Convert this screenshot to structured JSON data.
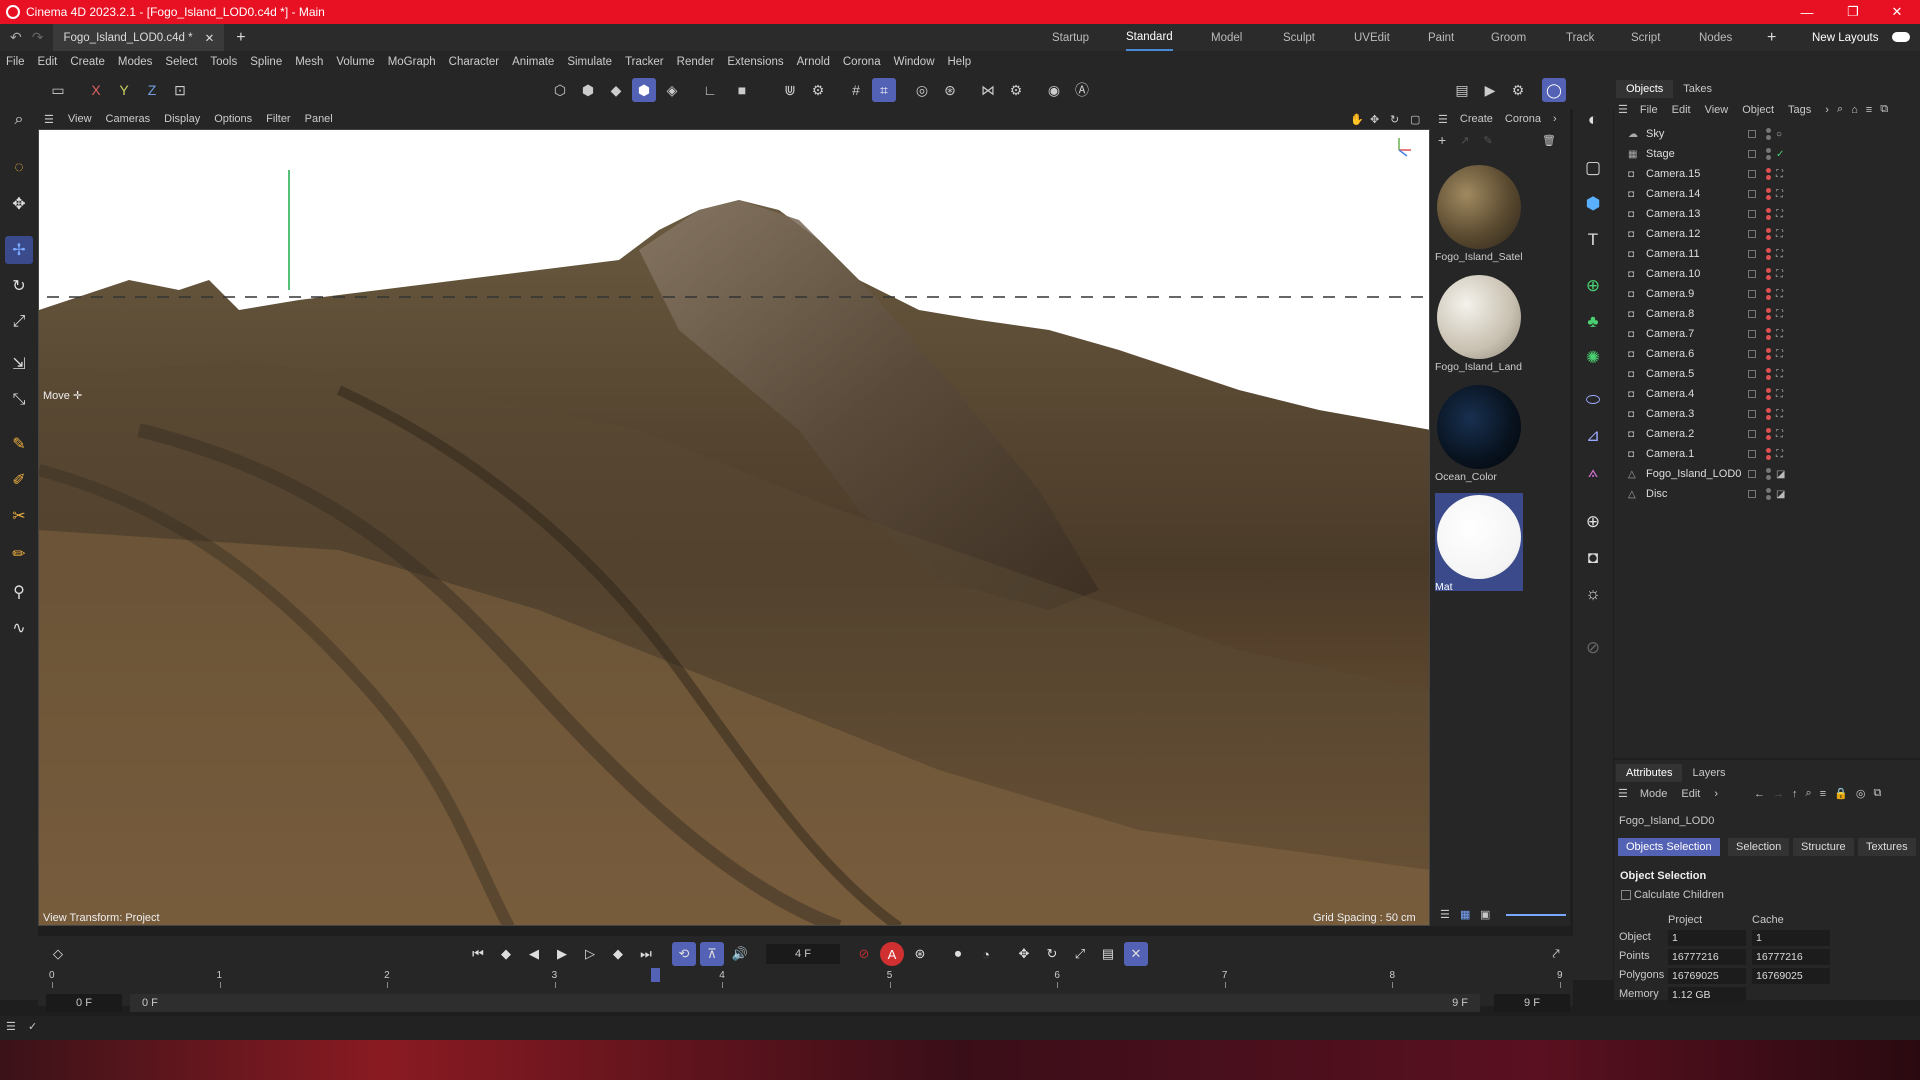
{
  "window": {
    "title": "Cinema 4D 2023.2.1 - [Fogo_Island_LOD0.c4d *] - Main",
    "min": "—",
    "max": "❐",
    "close": "✕"
  },
  "doc_tab": "Fogo_Island_LOD0.c4d *",
  "layouts": [
    "Startup",
    "Standard",
    "Model",
    "Sculpt",
    "UVEdit",
    "Paint",
    "Groom",
    "Track",
    "Script",
    "Nodes"
  ],
  "new_layouts": "New Layouts",
  "menu": [
    "File",
    "Edit",
    "Create",
    "Modes",
    "Select",
    "Tools",
    "Spline",
    "Mesh",
    "Volume",
    "MoGraph",
    "Character",
    "Animate",
    "Simulate",
    "Tracker",
    "Render",
    "Extensions",
    "Arnold",
    "Corona",
    "Window",
    "Help"
  ],
  "axes": [
    "X",
    "Y",
    "Z"
  ],
  "viewport": {
    "menu": [
      "View",
      "Cameras",
      "Display",
      "Options",
      "Filter",
      "Panel"
    ],
    "move_label": "Move",
    "view_transform": "View Transform: Project",
    "grid_spacing": "Grid Spacing : 50 cm"
  },
  "materials": {
    "menu": [
      "Create",
      "Corona"
    ],
    "items": [
      "Fogo_Island_Satel",
      "Fogo_Island_Land",
      "Ocean_Color",
      "Mat"
    ]
  },
  "objects": {
    "tabs": [
      "Objects",
      "Takes"
    ],
    "menu": [
      "File",
      "Edit",
      "View",
      "Object",
      "Tags"
    ],
    "rows": [
      "Sky",
      "Stage",
      "Camera.15",
      "Camera.14",
      "Camera.13",
      "Camera.12",
      "Camera.11",
      "Camera.10",
      "Camera.9",
      "Camera.8",
      "Camera.7",
      "Camera.6",
      "Camera.5",
      "Camera.4",
      "Camera.3",
      "Camera.2",
      "Camera.1",
      "Fogo_Island_LOD0",
      "Disc"
    ]
  },
  "attributes": {
    "tabs": [
      "Attributes",
      "Layers"
    ],
    "menu": [
      "Mode",
      "Edit"
    ],
    "object_name": "Fogo_Island_LOD0",
    "buttons": [
      "Objects Selection",
      "Selection",
      "Structure",
      "Textures"
    ],
    "section": "Object Selection",
    "calc_children": "Calculate Children",
    "col_project": "Project",
    "col_cache": "Cache",
    "rows": [
      {
        "label": "Object",
        "project": "1",
        "cache": "1"
      },
      {
        "label": "Points",
        "project": "16777216",
        "cache": "16777216"
      },
      {
        "label": "Polygons",
        "project": "16769025",
        "cache": "16769025"
      },
      {
        "label": "Memory",
        "project": "1.12 GB",
        "cache": ""
      }
    ]
  },
  "timeline": {
    "frame": "4 F",
    "ticks": [
      "0",
      "1",
      "2",
      "3",
      "4",
      "5",
      "6",
      "7",
      "8",
      "9"
    ],
    "start": "0 F",
    "start2": "0 F",
    "end": "9 F",
    "end2": "9 F",
    "current_fraction": 0.4
  }
}
